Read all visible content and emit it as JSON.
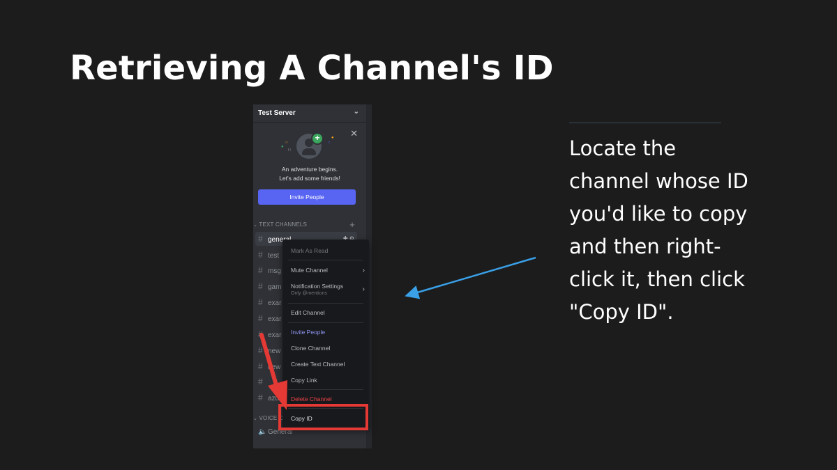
{
  "slide": {
    "title": "Retrieving A Channel's ID",
    "instruction": "Locate the channel whose ID you'd like to copy and then right-click it, then click \"Copy ID\"."
  },
  "discord": {
    "server_name": "Test Server",
    "welcome": {
      "line1": "An adventure begins.",
      "line2": "Let's add some friends!",
      "invite_button": "Invite People"
    },
    "text_category": "TEXT CHANNELS",
    "channels": [
      {
        "name": "general",
        "selected": true
      },
      {
        "name": "test",
        "selected": false
      },
      {
        "name": "msg",
        "selected": false
      },
      {
        "name": "gam",
        "selected": false
      },
      {
        "name": "exar",
        "selected": false
      },
      {
        "name": "exar",
        "selected": false
      },
      {
        "name": "exar",
        "selected": false
      },
      {
        "name": "new",
        "selected": false
      },
      {
        "name": "new",
        "selected": false
      },
      {
        "name": "",
        "selected": false
      },
      {
        "name": "azur",
        "selected": false
      }
    ],
    "voice_category": "VOICE C",
    "voice_channel": "General"
  },
  "context_menu": {
    "mark_as_read": "Mark As Read",
    "mute_channel": "Mute Channel",
    "notification_settings": "Notification Settings",
    "notification_sub": "Only @mentions",
    "edit_channel": "Edit Channel",
    "invite_people": "Invite People",
    "clone_channel": "Clone Channel",
    "create_text_channel": "Create Text Channel",
    "copy_link": "Copy Link",
    "delete_channel": "Delete Channel",
    "copy_id": "Copy ID"
  },
  "colors": {
    "accent_blue": "#5865f2",
    "danger_red": "#ed4245",
    "annotation_red": "#e53935",
    "annotation_blue": "#3aa0e8"
  }
}
